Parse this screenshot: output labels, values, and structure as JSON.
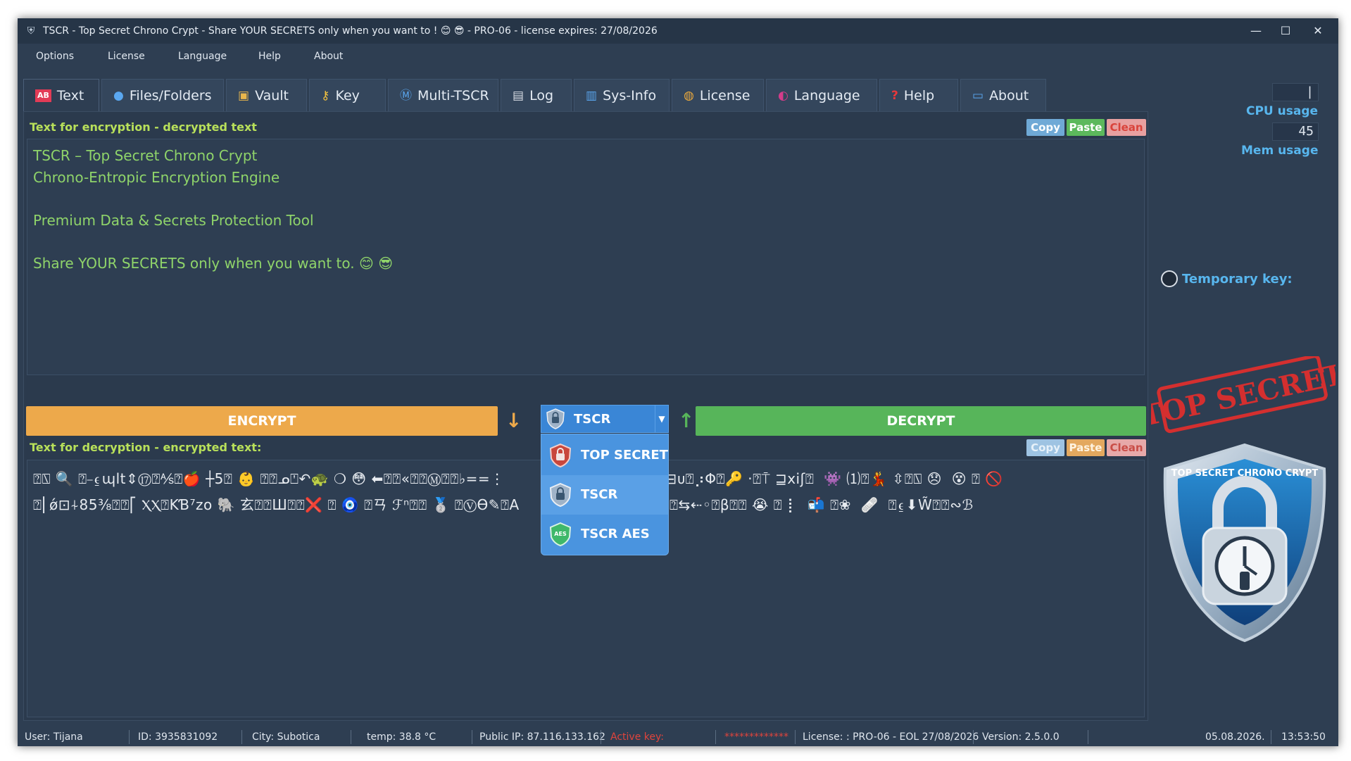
{
  "window": {
    "title": "TSCR - Top Secret Chrono Crypt - Share YOUR SECRETS only when you want to ! 😊 😎 - PRO-06 - license expires: 27/08/2026",
    "controls": {
      "minimize": "—",
      "maximize": "☐",
      "close": "✕"
    }
  },
  "menu": [
    "Options",
    "License",
    "Language",
    "Help",
    "About"
  ],
  "tabs": [
    {
      "label": "Text",
      "icon": "ab-icon",
      "glyph": "AB"
    },
    {
      "label": "Files/Folders",
      "icon": "globe-icon",
      "glyph": "●"
    },
    {
      "label": "Vault",
      "icon": "vault-icon",
      "glyph": "▣"
    },
    {
      "label": "Key",
      "icon": "key-icon",
      "glyph": "⚷"
    },
    {
      "label": "Multi-TSCR",
      "icon": "m-icon",
      "glyph": "Ⓜ"
    },
    {
      "label": "Log",
      "icon": "log-icon",
      "glyph": "▤"
    },
    {
      "label": "Sys-Info",
      "icon": "chart-icon",
      "glyph": "▥"
    },
    {
      "label": "License",
      "icon": "money-bag-icon",
      "glyph": "◍"
    },
    {
      "label": "Language",
      "icon": "lips-icon",
      "glyph": "◐"
    },
    {
      "label": "Help",
      "icon": "question-icon",
      "glyph": "?"
    },
    {
      "label": "About",
      "icon": "info-icon",
      "glyph": "▭"
    }
  ],
  "encrypt_section": {
    "label": "Text for encryption - decrypted text",
    "copy": "Copy",
    "paste": "Paste",
    "clean": "Clean",
    "text": "TSCR – Top Secret Chrono Crypt\nChrono-Entropic Encryption Engine\n\nPremium Data & Secrets Protection Tool\n\nShare YOUR SECRETS only when you want to. 😊 😎"
  },
  "actions": {
    "encrypt": "ENCRYPT",
    "decrypt": "DECRYPT",
    "down_arrow": "↓",
    "up_arrow": "↑",
    "algorithm_selected": "TSCR",
    "algorithm_options": [
      "TOP SECRET",
      "TSCR",
      "TSCR AES"
    ],
    "aes_badge": "AES"
  },
  "decrypt_section": {
    "label": "Text for decryption - encrypted text:",
    "copy": "Copy",
    "paste": "Paste",
    "clean": "Clean",
    "text": "⍰⍂ 🔍 ⍰⎯⍷ɰlt⇕⑰⍰⅍⍰🍎 ┼5⍰ 👶 ⍰⍰ᓄ⍞↶🐢 ❍ 😳 ⬅⍰⍰«⍰⍰Ⓜ⍰⍰♭==⋮          🚩 M⍰ ↓XII⍰⼠⍰⊟ᴜ⍰⡰Φ⍰🔑 ·⍰⍑ ⊒xiʃ⍰  👾 ⑴⍰💃 ⇳⍰⍂ 😞  😵 ⍰ 🚫\n⍰⎢ǿ⊡⍭85⅜⍰⍰⎡ ⲬⲬ⍰KƁ⁷zo 🐘 ⽞⍰⍰Ш⍰⍰❌ ⍰ 🧿 ⍰ㄢ ℱⁿ⍰⍰ 🥈 ⍰ⓋƟ✎⍰A            ⍰s⍰⍰ 𐊆⍰⍰┼⍰⍰⍰⇆⇠◦⍰β⍰⍰ 😭 ⍰ ⡇  📬 ⍰❀  🩹  ⍰⍷⬇W̃⍰⍰∾ℬ"
  },
  "right_pane": {
    "cpu_value": "|",
    "cpu_label": "CPU usage",
    "mem_value": "45",
    "mem_label": "Mem usage",
    "temp_key_label": "Temporary key:",
    "stamp_text": "TOP SECRET",
    "logo_text": "TOP SECRET CHRONO CRYPT"
  },
  "status": {
    "user": "User: Tijana",
    "id": "ID: 3935831092",
    "city": "City: Subotica",
    "temp": "temp: 38.8 °C",
    "ip": "Public IP: 87.116.133.162",
    "active_key": "Active key:",
    "key_mask": "*************",
    "license": "License: : PRO-06 - EOL 27/08/2026",
    "version": "Version: 2.5.0.0",
    "date": "05.08.2026.",
    "time": "13:53:50"
  },
  "colors": {
    "background": "#2e3e52",
    "label_green": "#b8e05a",
    "text_green": "#8fd46a",
    "encrypt": "#eda94b",
    "decrypt": "#57b55a",
    "accent_blue": "#3a86d6",
    "usage_blue": "#58b6ee",
    "stamp_red": "#d42f2f"
  }
}
